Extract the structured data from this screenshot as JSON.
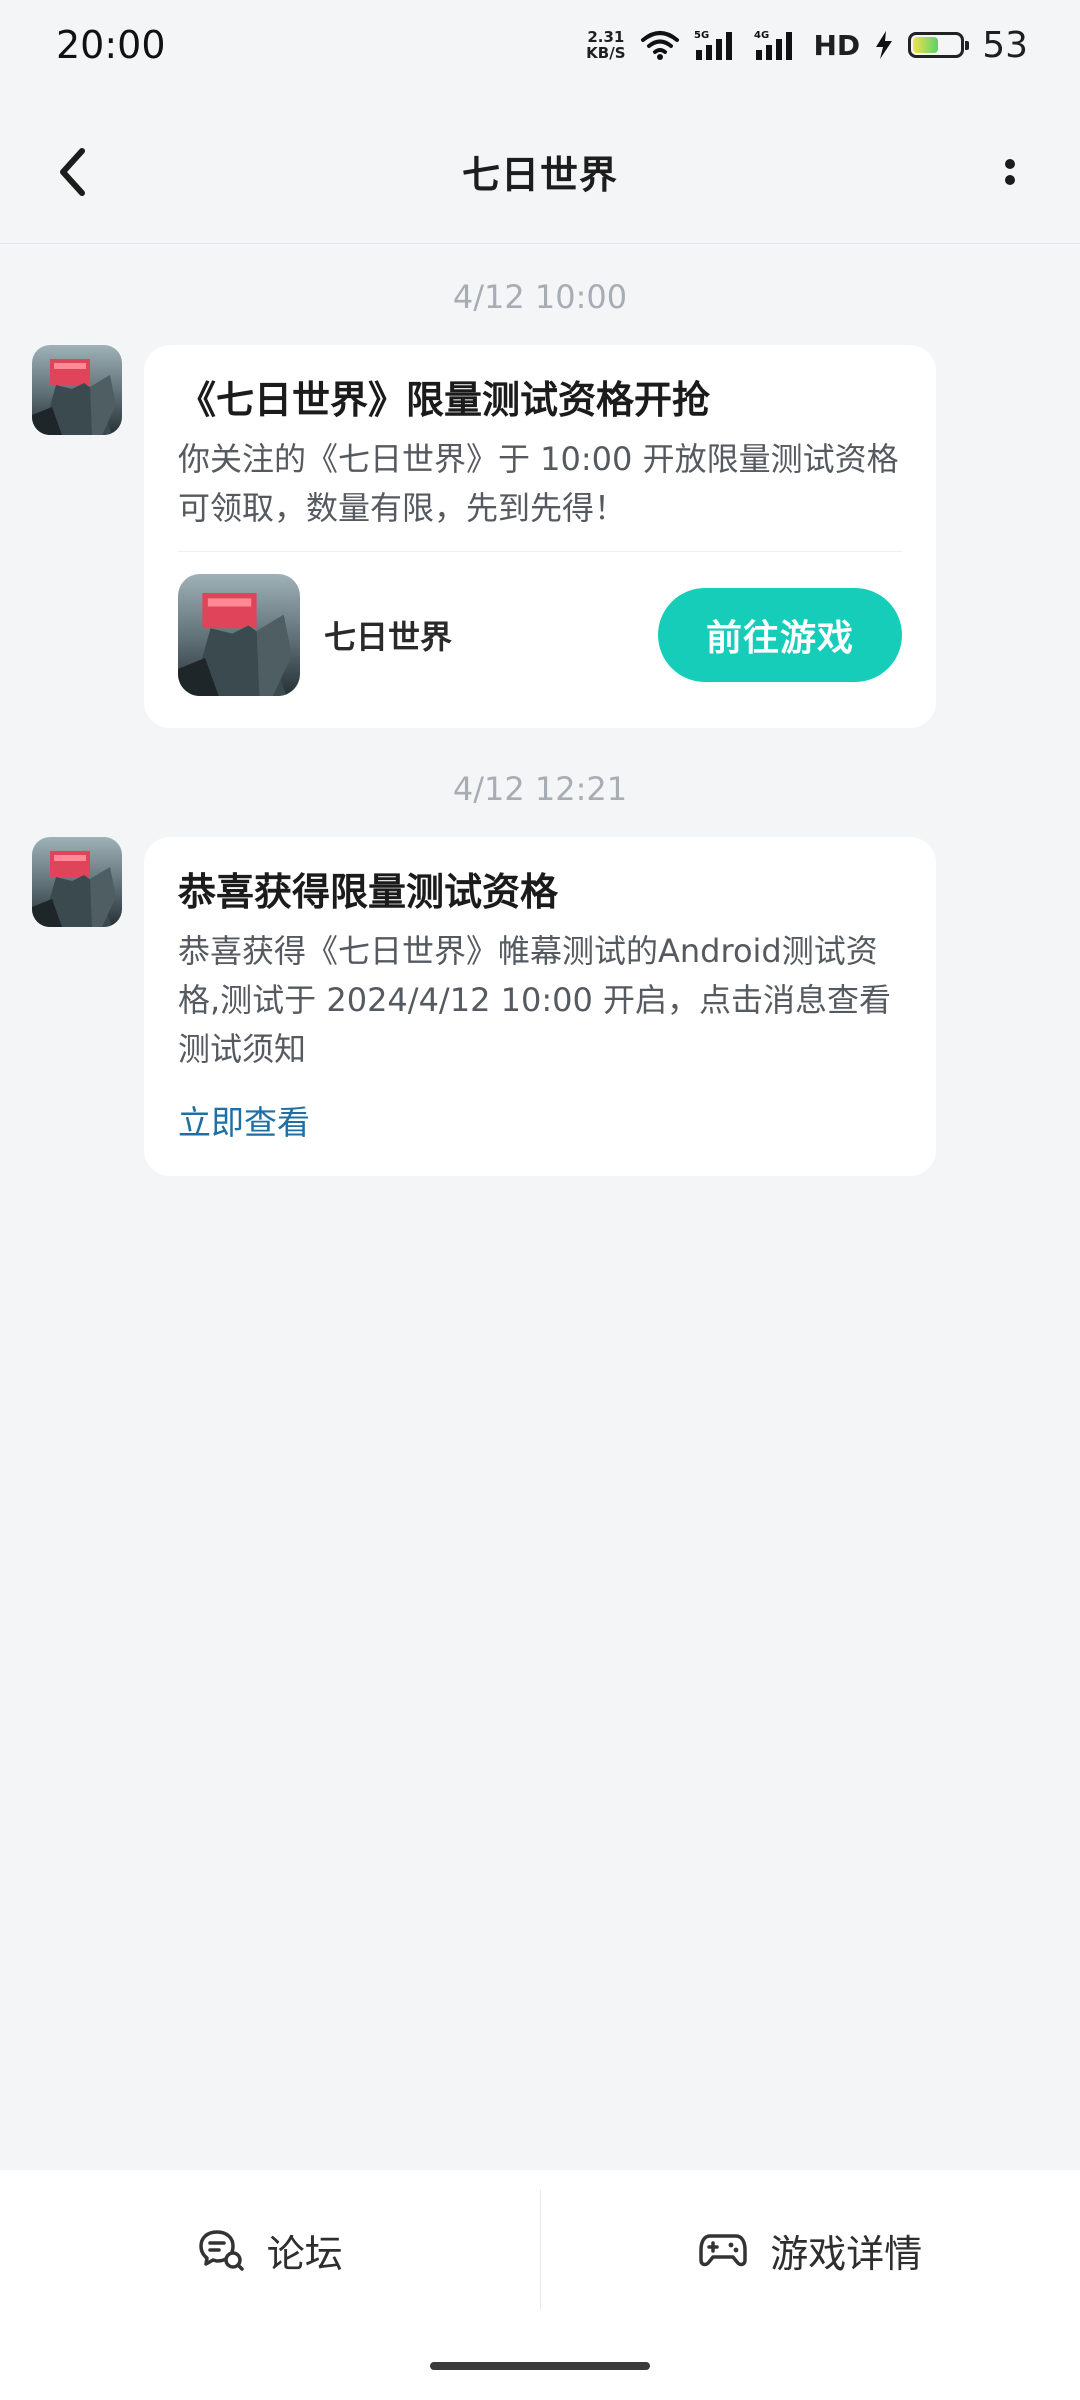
{
  "status_bar": {
    "time": "20:00",
    "net_speed_value": "2.31",
    "net_speed_unit": "KB/S",
    "hd_label": "HD",
    "battery": "53",
    "battery_level_percent": 53,
    "icons": [
      "wifi-icon",
      "signal-5g-icon",
      "signal-4g-icon",
      "charging-icon",
      "battery-icon"
    ]
  },
  "header": {
    "title": "七日世界",
    "back_icon": "chevron-left-icon",
    "more_icon": "more-vertical-icon"
  },
  "messages": [
    {
      "timestamp": "4/12  10:00",
      "title": "《七日世界》限量测试资格开抢",
      "body": "你关注的《七日世界》于 10:00 开放限量测试资格可领取，数量有限，先到先得！",
      "game_name": "七日世界",
      "button_label": "前往游戏"
    },
    {
      "timestamp": "4/12  12:21",
      "title": "恭喜获得限量测试资格",
      "body": "恭喜获得《七日世界》帷幕测试的Android测试资格,测试于 2024/4/12 10:00 开启，点击消息查看测试须知",
      "link_label": "立即查看"
    }
  ],
  "bottom_bar": {
    "tabs": [
      {
        "label": "论坛",
        "icon": "forum-chat-icon"
      },
      {
        "label": "游戏详情",
        "icon": "gamepad-icon"
      }
    ]
  },
  "colors": {
    "accent": "#16cdb9",
    "link": "#1d6fa5",
    "background": "#f4f5f7"
  }
}
